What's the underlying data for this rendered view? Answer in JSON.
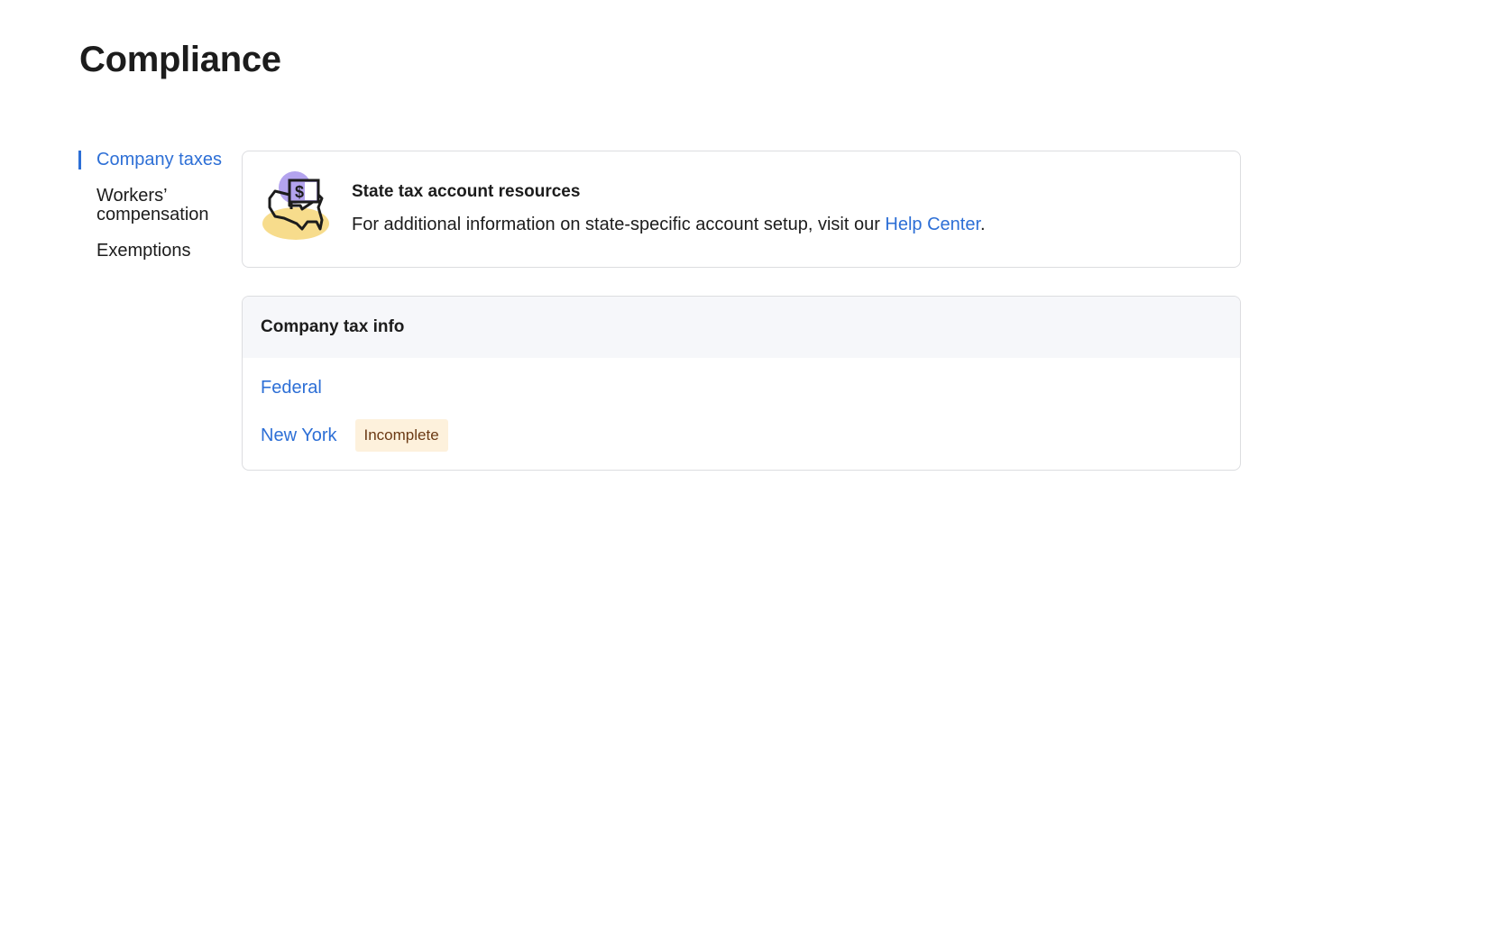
{
  "page": {
    "title": "Compliance"
  },
  "sidebar": {
    "items": [
      {
        "label": "Company taxes",
        "active": true
      },
      {
        "label": "Workers’ compensation"
      },
      {
        "label": "Exemptions"
      }
    ]
  },
  "resources": {
    "icon": "us-map-tax-illustration",
    "title": "State tax account resources",
    "text_before": "For additional information on state-specific account setup, visit our ",
    "link": "Help Center",
    "text_after": "."
  },
  "tax_info": {
    "title": "Company tax info",
    "rows": [
      {
        "label": "Federal"
      },
      {
        "label": "New York",
        "status": "Incomplete"
      }
    ]
  },
  "colors": {
    "accent": "#2d6fd6",
    "badge_bg": "#fdf1dc",
    "badge_text": "#6b3a14"
  }
}
